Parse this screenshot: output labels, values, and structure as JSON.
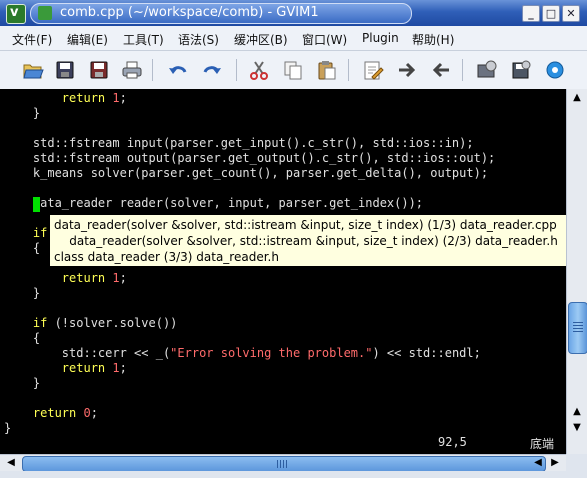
{
  "window": {
    "title": "comb.cpp (~/workspace/comb) - GVIM1",
    "icon": "gvim-icon",
    "controls": {
      "minimize": "_",
      "maximize": "□",
      "close": "✕"
    }
  },
  "menu": {
    "items": [
      "文件(F)",
      "编辑(E)",
      "工具(T)",
      "语法(S)",
      "缓冲区(B)",
      "窗口(W)",
      "Plugin",
      "帮助(H)"
    ]
  },
  "toolbar": {
    "icons": [
      "open-icon",
      "save-icon",
      "save-all-icon",
      "print-icon",
      "undo-icon",
      "redo-icon",
      "cut-icon",
      "copy-icon",
      "paste-icon",
      "find-replace-icon",
      "forward-icon",
      "back-icon",
      "load-session-icon",
      "save-session-icon",
      "run-script-icon"
    ]
  },
  "editor": {
    "lines": [
      {
        "indent": "        ",
        "segments": [
          {
            "t": "return",
            "c": "kw"
          },
          {
            "t": " ",
            "c": ""
          },
          {
            "t": "1",
            "c": "num"
          },
          {
            "t": ";",
            "c": ""
          }
        ]
      },
      {
        "indent": "    ",
        "segments": [
          {
            "t": "}",
            "c": ""
          }
        ]
      },
      {
        "indent": "",
        "segments": []
      },
      {
        "indent": "    ",
        "segments": [
          {
            "t": "std::fstream input(parser.get_input().c_str(), std::ios::in);",
            "c": ""
          }
        ]
      },
      {
        "indent": "    ",
        "segments": [
          {
            "t": "std::fstream output(parser.get_output().c_str(), std::ios::out);",
            "c": ""
          }
        ]
      },
      {
        "indent": "    ",
        "segments": [
          {
            "t": "k_means solver(parser.get_count(), parser.get_delta(), output);",
            "c": ""
          }
        ]
      },
      {
        "indent": "",
        "segments": []
      },
      {
        "indent": "    ",
        "segments": [
          {
            "t": "data_reader reader(solver, input, parser.get_index());",
            "c": ""
          }
        ]
      },
      {
        "indent": "",
        "segments": []
      },
      {
        "indent": "    ",
        "segments": [
          {
            "t": "if",
            "c": "kw"
          }
        ]
      },
      {
        "indent": "    ",
        "segments": [
          {
            "t": "{",
            "c": ""
          }
        ]
      },
      {
        "indent": "",
        "segments": []
      },
      {
        "indent": "        ",
        "segments": [
          {
            "t": "return",
            "c": "kw"
          },
          {
            "t": " ",
            "c": ""
          },
          {
            "t": "1",
            "c": "num"
          },
          {
            "t": ";",
            "c": ""
          }
        ]
      },
      {
        "indent": "    ",
        "segments": [
          {
            "t": "}",
            "c": ""
          }
        ]
      },
      {
        "indent": "",
        "segments": []
      },
      {
        "indent": "    ",
        "segments": [
          {
            "t": "if",
            "c": "kw"
          },
          {
            "t": " (!solver.solve())",
            "c": ""
          }
        ]
      },
      {
        "indent": "    ",
        "segments": [
          {
            "t": "{",
            "c": ""
          }
        ]
      },
      {
        "indent": "        ",
        "segments": [
          {
            "t": "std::cerr << _(",
            "c": ""
          },
          {
            "t": "\"Error solving the problem.\"",
            "c": "str"
          },
          {
            "t": ") << std::endl;",
            "c": ""
          }
        ]
      },
      {
        "indent": "        ",
        "segments": [
          {
            "t": "return",
            "c": "kw"
          },
          {
            "t": " ",
            "c": ""
          },
          {
            "t": "1",
            "c": "num"
          },
          {
            "t": ";",
            "c": ""
          }
        ]
      },
      {
        "indent": "    ",
        "segments": [
          {
            "t": "}",
            "c": ""
          }
        ]
      },
      {
        "indent": "",
        "segments": []
      },
      {
        "indent": "    ",
        "segments": [
          {
            "t": "return",
            "c": "kw"
          },
          {
            "t": " ",
            "c": ""
          },
          {
            "t": "0",
            "c": "num"
          },
          {
            "t": ";",
            "c": ""
          }
        ]
      },
      {
        "indent": "",
        "segments": [
          {
            "t": "}",
            "c": ""
          }
        ]
      }
    ],
    "completion_popup": [
      "data_reader(solver &solver, std::istream &input, size_t index) (1/3) data_reader.cpp",
      "    data_reader(solver &solver, std::istream &input, size_t index) (2/3) data_reader.h",
      "class data_reader (3/3) data_reader.h"
    ],
    "status_position": "92,5",
    "status_scroll": "底端"
  },
  "colors": {
    "background": "#000000",
    "keyword": "#ffff55",
    "string": "#ff6b6b",
    "cursor": "#00e000",
    "popup_bg": "#ffffe0"
  }
}
